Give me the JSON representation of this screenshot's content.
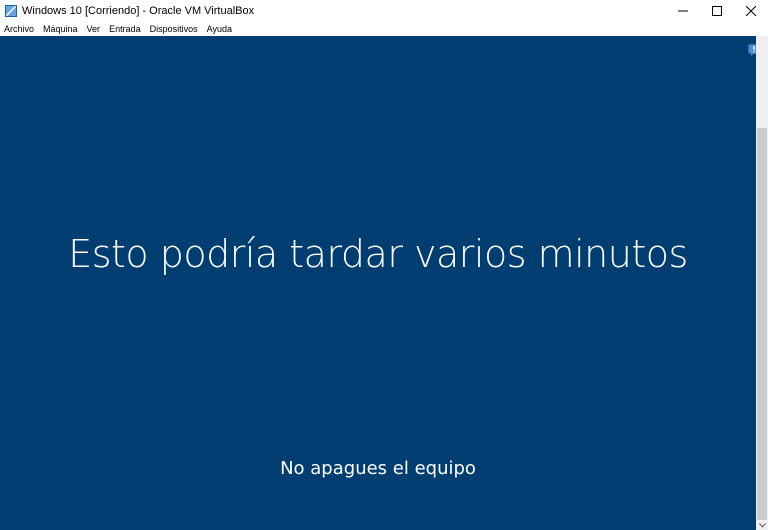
{
  "window": {
    "title": "Windows 10 [Corriendo] - Oracle VM VirtualBox",
    "icon": "virtualbox-icon",
    "controls": [
      "minimize-icon",
      "maximize-icon",
      "close-icon"
    ]
  },
  "menu": {
    "items": [
      {
        "label": "Archivo"
      },
      {
        "label": "Máquina"
      },
      {
        "label": "Ver"
      },
      {
        "label": "Entrada"
      },
      {
        "label": "Dispositivos"
      },
      {
        "label": "Ayuda"
      }
    ]
  },
  "vm": {
    "background_color": "#003e71",
    "heading": "Esto podría tardar varios minutos",
    "subheading": "No apagues el equipo",
    "notification_icon": "notification-icon"
  }
}
